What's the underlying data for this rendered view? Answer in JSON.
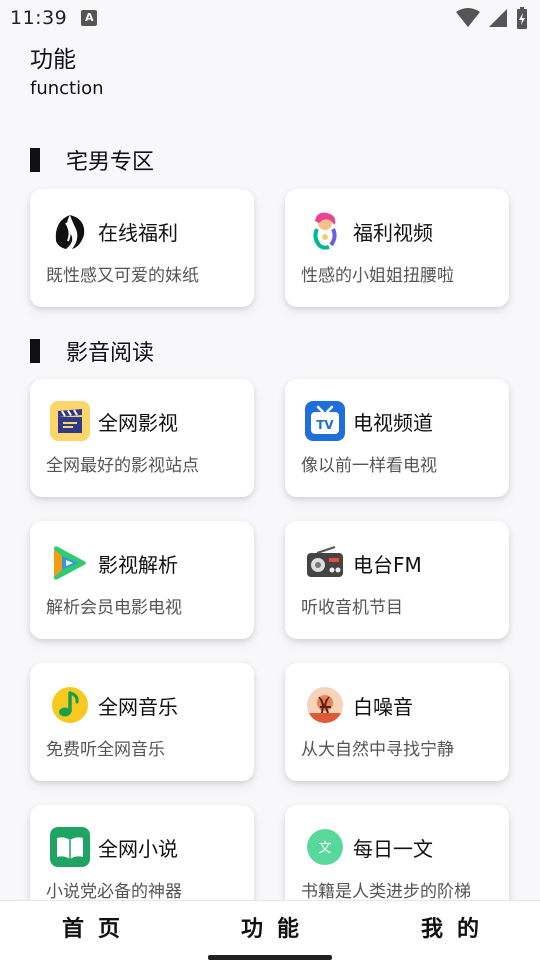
{
  "status": {
    "time": "11:39",
    "notif_letter": "A"
  },
  "header": {
    "title": "功能",
    "subtitle": "function"
  },
  "sections": [
    {
      "title": "宅男专区",
      "cards": [
        {
          "title": "在线福利",
          "desc": "既性感又可爱的妹纸",
          "icon": "black-swirl-logo-icon"
        },
        {
          "title": "福利视频",
          "desc": "性感的小姐姐扭腰啦",
          "icon": "colorful-girl-sticker-icon"
        }
      ]
    },
    {
      "title": "影音阅读",
      "cards": [
        {
          "title": "全网影视",
          "desc": "全网最好的影视站点",
          "icon": "clapperboard-icon"
        },
        {
          "title": "电视频道",
          "desc": "像以前一样看电视",
          "icon": "tv-icon",
          "badge": "TV"
        },
        {
          "title": "影视解析",
          "desc": "解析会员电影电视",
          "icon": "play-triangle-icon"
        },
        {
          "title": "电台FM",
          "desc": "听收音机节目",
          "icon": "radio-icon"
        },
        {
          "title": "全网音乐",
          "desc": "免费听全网音乐",
          "icon": "music-note-icon"
        },
        {
          "title": "白噪音",
          "desc": "从大自然中寻找宁静",
          "icon": "sunset-deer-icon"
        },
        {
          "title": "全网小说",
          "desc": "小说党必备的神器",
          "icon": "book-icon"
        },
        {
          "title": "每日一文",
          "desc": "书籍是人类进步的阶梯",
          "icon": "wen-text-icon",
          "badge": "文"
        }
      ]
    }
  ],
  "nav": {
    "home": "首页",
    "function": "功能",
    "mine": "我的"
  },
  "colors": {
    "background": "#f8f8fa",
    "card": "#ffffff",
    "text": "#111111",
    "muted": "#555555"
  }
}
